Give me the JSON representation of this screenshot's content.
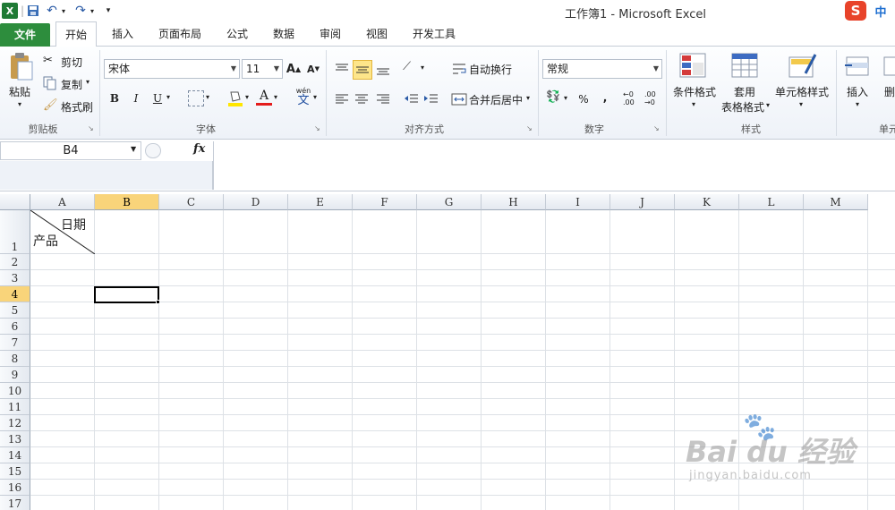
{
  "window": {
    "title": "工作簿1 - Microsoft Excel"
  },
  "ime": {
    "badge": "中"
  },
  "tabs": [
    "文件",
    "开始",
    "插入",
    "页面布局",
    "公式",
    "数据",
    "审阅",
    "视图",
    "开发工具"
  ],
  "clipboard": {
    "paste": "粘贴",
    "cut": "剪切",
    "copy": "复制",
    "format_painter": "格式刷",
    "group": "剪贴板"
  },
  "font": {
    "name": "宋体",
    "size": "11",
    "group": "字体",
    "bold": "B",
    "italic": "I",
    "underline": "U",
    "grow": "A",
    "shrink": "A",
    "color_a": "A",
    "phonetic": "wén"
  },
  "alignment": {
    "wrap": "自动换行",
    "merge": "合并后居中",
    "group": "对齐方式"
  },
  "number": {
    "format": "常规",
    "percent": "%",
    "comma": ",",
    "group": "数字"
  },
  "styles": {
    "cond": "条件格式",
    "table_line1": "套用",
    "table_line2": "表格格式",
    "cell": "单元格样式",
    "group": "样式"
  },
  "cells": {
    "insert": "插入",
    "delete": "删",
    "group": "单元"
  },
  "formula": {
    "namebox": "B4",
    "fx": "fx",
    "content": ""
  },
  "columns": [
    "A",
    "B",
    "C",
    "D",
    "E",
    "F",
    "G",
    "H",
    "I",
    "J",
    "K",
    "L",
    "M"
  ],
  "rows": [
    "1",
    "2",
    "3",
    "4",
    "5",
    "6",
    "7",
    "8",
    "9",
    "10",
    "11",
    "12",
    "13",
    "14",
    "15",
    "16",
    "17"
  ],
  "selected": {
    "column": "B",
    "row": "4"
  },
  "cell_a1": {
    "top_right": "日期",
    "bottom_left": "产品"
  },
  "watermark": {
    "brand": "Bai du 经验",
    "url": "jingyan.baidu.com"
  }
}
